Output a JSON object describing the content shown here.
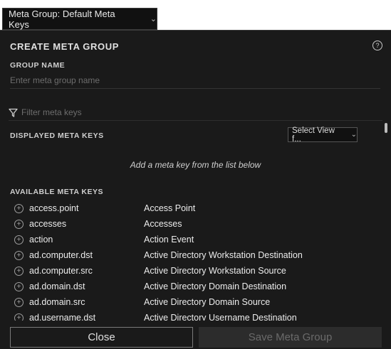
{
  "header": {
    "group_dropdown_label": "Meta Group: Default Meta Keys"
  },
  "panel": {
    "title": "CREATE META GROUP",
    "help_glyph": "?",
    "group_name_label": "GROUP NAME",
    "group_name_placeholder": "Enter meta group name",
    "filter_placeholder": "Filter meta keys",
    "displayed_label": "DISPLAYED META KEYS",
    "view_select_value": "Select View f...",
    "empty_message": "Add a meta key from the list below",
    "available_label": "AVAILABLE META KEYS"
  },
  "available_keys": [
    {
      "key": "access.point",
      "desc": "Access Point"
    },
    {
      "key": "accesses",
      "desc": "Accesses"
    },
    {
      "key": "action",
      "desc": "Action Event"
    },
    {
      "key": "ad.computer.dst",
      "desc": "Active Directory Workstation Destination"
    },
    {
      "key": "ad.computer.src",
      "desc": "Active Directory Workstation Source"
    },
    {
      "key": "ad.domain.dst",
      "desc": "Active Directory Domain Destination"
    },
    {
      "key": "ad.domain.src",
      "desc": "Active Directory Domain Source"
    },
    {
      "key": "ad.username.dst",
      "desc": "Active Directory Username Destination"
    }
  ],
  "footer": {
    "close_label": "Close",
    "save_label": "Save Meta Group"
  },
  "icons": {
    "filter": "filter-funnel-icon",
    "help": "help-circle-icon",
    "add": "add-circle-icon",
    "chevron": "chevron-down-icon"
  }
}
